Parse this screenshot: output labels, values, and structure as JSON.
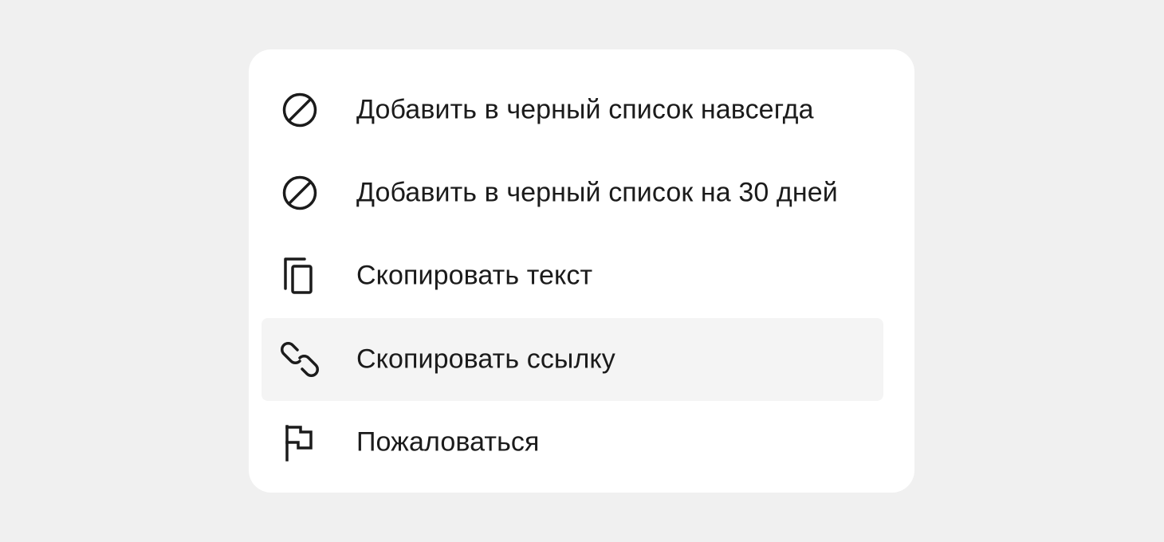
{
  "menu": {
    "items": [
      {
        "label": "Добавить в черный список навсегда",
        "icon": "block-icon"
      },
      {
        "label": "Добавить в черный список на 30 дней",
        "icon": "block-icon"
      },
      {
        "label": "Скопировать текст",
        "icon": "copy-icon"
      },
      {
        "label": "Скопировать ссылку",
        "icon": "link-icon",
        "highlighted": true
      },
      {
        "label": "Пожаловаться",
        "icon": "flag-icon"
      }
    ]
  },
  "colors": {
    "page_background": "#f0f0f0",
    "menu_background": "#ffffff",
    "hover_background": "#f4f4f4",
    "text": "#1b1b1b"
  }
}
